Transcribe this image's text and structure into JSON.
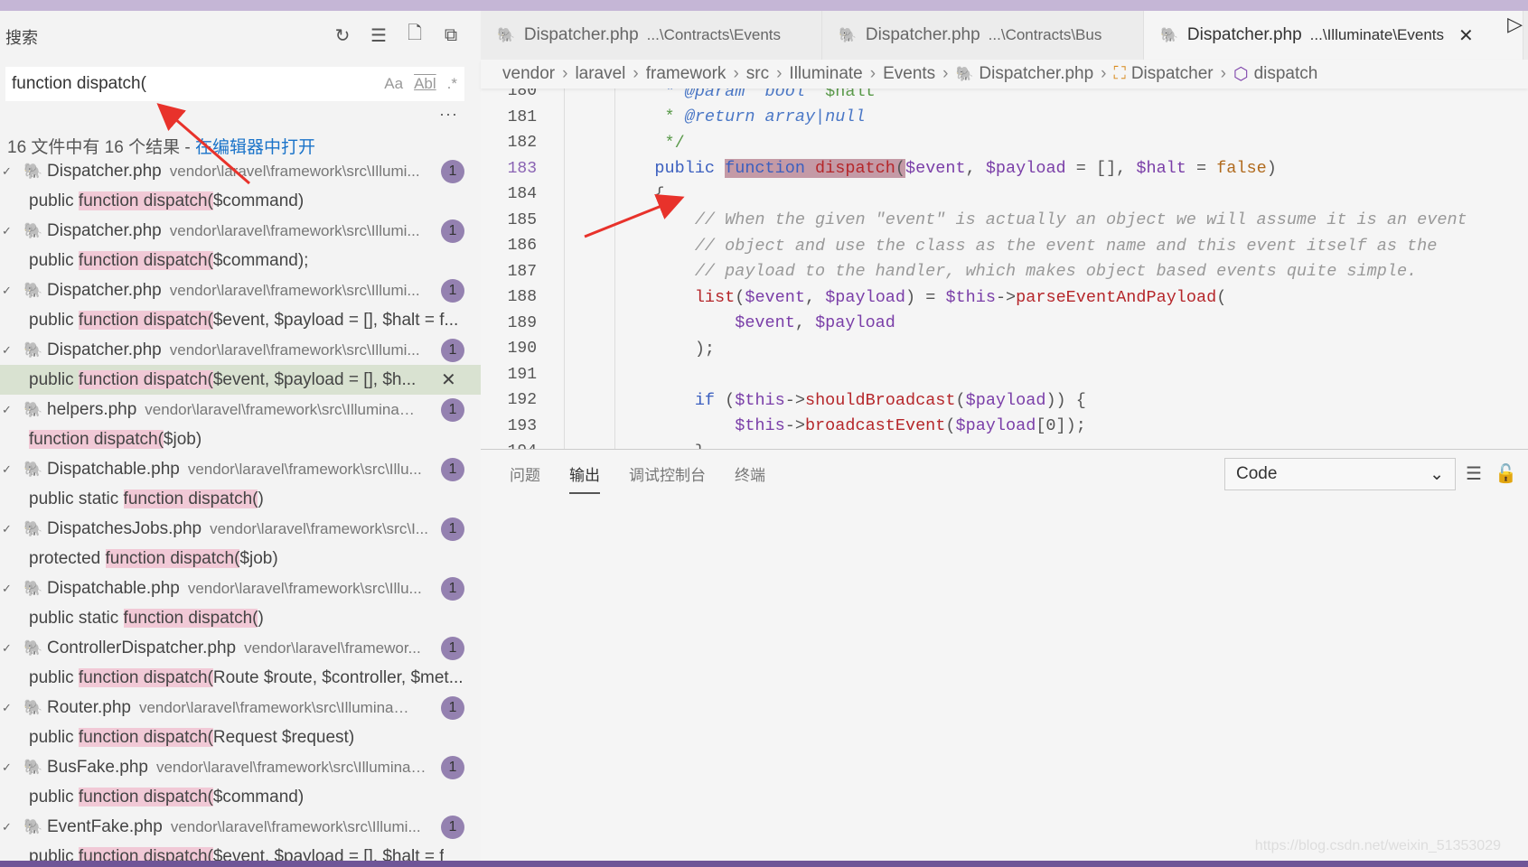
{
  "sidebar": {
    "title": "搜索",
    "actions": [
      "refresh-icon",
      "clear-results-icon",
      "new-search-editor-icon",
      "collapse-all-icon"
    ],
    "search": {
      "value": "function dispatch(",
      "match_case": "Aa",
      "whole_word": "Abl",
      "regex": ".*"
    },
    "more": "···",
    "summary": {
      "text": "16 文件中有 16 个结果 - ",
      "link": "在编辑器中打开"
    },
    "results": [
      {
        "file": "Dispatcher.php",
        "path": "vendor\\laravel\\framework\\src\\Illumi...",
        "count": "1",
        "pre": "public ",
        "hl": "function dispatch(",
        "post": "$command)"
      },
      {
        "file": "Dispatcher.php",
        "path": "vendor\\laravel\\framework\\src\\Illumi...",
        "count": "1",
        "pre": "public ",
        "hl": "function dispatch(",
        "post": "$command);"
      },
      {
        "file": "Dispatcher.php",
        "path": "vendor\\laravel\\framework\\src\\Illumi...",
        "count": "1",
        "pre": "public ",
        "hl": "function dispatch(",
        "post": "$event, $payload = [], $halt = f..."
      },
      {
        "file": "Dispatcher.php",
        "path": "vendor\\laravel\\framework\\src\\Illumi...",
        "count": "1",
        "pre": "public ",
        "hl": "function dispatch(",
        "post": "$event, $payload = [], $h...",
        "selected": true
      },
      {
        "file": "helpers.php",
        "path": "vendor\\laravel\\framework\\src\\Illuminat...",
        "count": "1",
        "pre": "",
        "hl": "function dispatch(",
        "post": "$job)"
      },
      {
        "file": "Dispatchable.php",
        "path": "vendor\\laravel\\framework\\src\\Illu...",
        "count": "1",
        "pre": "public static ",
        "hl": "function dispatch(",
        "post": ")"
      },
      {
        "file": "DispatchesJobs.php",
        "path": "vendor\\laravel\\framework\\src\\I...",
        "count": "1",
        "pre": "protected ",
        "hl": "function dispatch(",
        "post": "$job)"
      },
      {
        "file": "Dispatchable.php",
        "path": "vendor\\laravel\\framework\\src\\Illu...",
        "count": "1",
        "pre": "public static ",
        "hl": "function dispatch(",
        "post": ")"
      },
      {
        "file": "ControllerDispatcher.php",
        "path": "vendor\\laravel\\framewor...",
        "count": "1",
        "pre": "public ",
        "hl": "function dispatch(",
        "post": "Route $route, $controller, $met..."
      },
      {
        "file": "Router.php",
        "path": "vendor\\laravel\\framework\\src\\Illuminate...",
        "count": "1",
        "pre": "public ",
        "hl": "function dispatch(",
        "post": "Request $request)"
      },
      {
        "file": "BusFake.php",
        "path": "vendor\\laravel\\framework\\src\\Illuminat...",
        "count": "1",
        "pre": "public ",
        "hl": "function dispatch(",
        "post": "$command)"
      },
      {
        "file": "EventFake.php",
        "path": "vendor\\laravel\\framework\\src\\Illumi...",
        "count": "1",
        "pre": "public ",
        "hl": "function dispatch(",
        "post": "$event, $payload = [], $halt = f"
      }
    ]
  },
  "tabs": [
    {
      "name": "Dispatcher.php",
      "path": "...\\Contracts\\Events"
    },
    {
      "name": "Dispatcher.php",
      "path": "...\\Contracts\\Bus"
    },
    {
      "name": "Dispatcher.php",
      "path": "...\\Illuminate\\Events",
      "active": true
    }
  ],
  "breadcrumb": [
    "vendor",
    "laravel",
    "framework",
    "src",
    "Illuminate",
    "Events",
    "Dispatcher.php",
    "Dispatcher",
    "dispatch"
  ],
  "code": {
    "current_line": "183",
    "lines": [
      {
        "n": "180",
        "t": [
          [
            "     * ",
            "dc"
          ],
          [
            "@param  bool  ",
            "dc"
          ],
          [
            "$halt",
            "dcs"
          ]
        ]
      },
      {
        "n": "181",
        "t": [
          [
            "     * ",
            "dcs"
          ],
          [
            "@return array|null",
            "dc"
          ]
        ]
      },
      {
        "n": "182",
        "t": [
          [
            "     */",
            "dcs"
          ]
        ]
      },
      {
        "n": "183",
        "t": [
          [
            "    public ",
            "kw"
          ],
          [
            "function ",
            "kw hlw"
          ],
          [
            "dispatch",
            "fn hlw"
          ],
          [
            "(",
            "pun hlw"
          ],
          [
            "$event",
            "var"
          ],
          [
            ", ",
            "pun"
          ],
          [
            "$payload",
            "var"
          ],
          [
            " = [], ",
            "pun"
          ],
          [
            "$halt",
            "var"
          ],
          [
            " = ",
            "pun"
          ],
          [
            "false",
            "lit"
          ],
          [
            ")",
            "pun"
          ]
        ]
      },
      {
        "n": "184",
        "t": [
          [
            "    {",
            "pun"
          ]
        ]
      },
      {
        "n": "185",
        "t": [
          [
            "        // When the given \"event\" is actually an object we will assume it is an event",
            "cm"
          ]
        ]
      },
      {
        "n": "186",
        "t": [
          [
            "        // object and use the class as the event name and this event itself as the",
            "cm"
          ]
        ]
      },
      {
        "n": "187",
        "t": [
          [
            "        // payload to the handler, which makes object based events quite simple.",
            "cm"
          ]
        ]
      },
      {
        "n": "188",
        "t": [
          [
            "        list",
            "fn"
          ],
          [
            "(",
            "pun"
          ],
          [
            "$event",
            "var"
          ],
          [
            ", ",
            "pun"
          ],
          [
            "$payload",
            "var"
          ],
          [
            ") = ",
            "pun"
          ],
          [
            "$this",
            "var"
          ],
          [
            "->",
            "pun"
          ],
          [
            "parseEventAndPayload",
            "fn"
          ],
          [
            "(",
            "pun"
          ]
        ]
      },
      {
        "n": "189",
        "t": [
          [
            "            $event",
            "var"
          ],
          [
            ", ",
            "pun"
          ],
          [
            "$payload",
            "var"
          ]
        ]
      },
      {
        "n": "190",
        "t": [
          [
            "        );",
            "pun"
          ]
        ]
      },
      {
        "n": "191",
        "t": []
      },
      {
        "n": "192",
        "t": [
          [
            "        if ",
            "kw"
          ],
          [
            "(",
            "pun"
          ],
          [
            "$this",
            "var"
          ],
          [
            "->",
            "pun"
          ],
          [
            "shouldBroadcast",
            "fn"
          ],
          [
            "(",
            "pun"
          ],
          [
            "$payload",
            "var"
          ],
          [
            ")) {",
            "pun"
          ]
        ]
      },
      {
        "n": "193",
        "t": [
          [
            "            $this",
            "var"
          ],
          [
            "->",
            "pun"
          ],
          [
            "broadcastEvent",
            "fn"
          ],
          [
            "(",
            "pun"
          ],
          [
            "$payload",
            "var"
          ],
          [
            "[0]);",
            "pun"
          ]
        ]
      },
      {
        "n": "194",
        "t": [
          [
            "        }",
            "pun"
          ]
        ]
      }
    ]
  },
  "panel": {
    "tabs": [
      "问题",
      "输出",
      "调试控制台",
      "终端"
    ],
    "active": "输出",
    "channel": "Code"
  },
  "watermark": "https://blog.csdn.net/weixin_51353029",
  "colors": {
    "accent": "#6f5597",
    "title_bar": "#c5b6d6",
    "match_highlight": "#f1c9d6",
    "arrow": "#e8322b"
  }
}
